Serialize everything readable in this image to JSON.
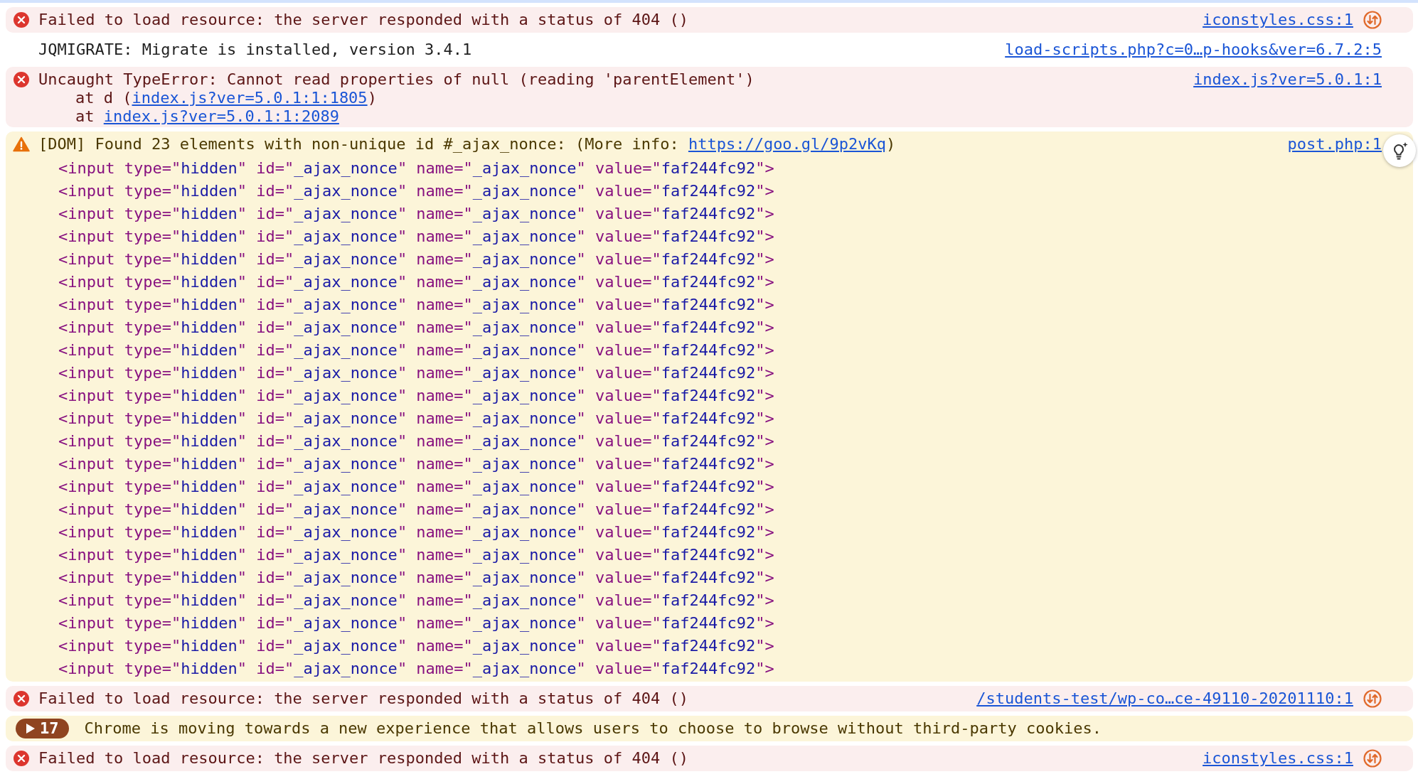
{
  "messages": [
    {
      "kind": "error",
      "text": "Failed to load resource: the server responded with a status of 404 ()",
      "source": "iconstyles.css:1",
      "network_icon": true
    },
    {
      "kind": "info",
      "text": "JQMIGRATE: Migrate is installed, version 3.4.1",
      "source": "load-scripts.php?c=0…p-hooks&ver=6.7.2:5"
    },
    {
      "kind": "error",
      "text": "Uncaught TypeError: Cannot read properties of null (reading 'parentElement')",
      "source": "index.js?ver=5.0.1:1",
      "stack": [
        {
          "prefix": "at d (",
          "link": "index.js?ver=5.0.1:1:1805",
          "suffix": ")"
        },
        {
          "prefix": "at ",
          "link": "index.js?ver=5.0.1:1:2089"
        }
      ]
    },
    {
      "kind": "warning",
      "text": "[DOM] Found 23 elements with non-unique id #_ajax_nonce: (More info: ",
      "link": "https://goo.gl/9p2vKq",
      "suffix": ")",
      "source": "post.php:1",
      "ai_button": true,
      "code_lines": [
        "<input type=\"hidden\" id=\"_ajax_nonce\" name=\"_ajax_nonce\" value=\"faf244fc92\">",
        "<input type=\"hidden\" id=\"_ajax_nonce\" name=\"_ajax_nonce\" value=\"faf244fc92\">",
        "<input type=\"hidden\" id=\"_ajax_nonce\" name=\"_ajax_nonce\" value=\"faf244fc92\">",
        "<input type=\"hidden\" id=\"_ajax_nonce\" name=\"_ajax_nonce\" value=\"faf244fc92\">",
        "<input type=\"hidden\" id=\"_ajax_nonce\" name=\"_ajax_nonce\" value=\"faf244fc92\">",
        "<input type=\"hidden\" id=\"_ajax_nonce\" name=\"_ajax_nonce\" value=\"faf244fc92\">",
        "<input type=\"hidden\" id=\"_ajax_nonce\" name=\"_ajax_nonce\" value=\"faf244fc92\">",
        "<input type=\"hidden\" id=\"_ajax_nonce\" name=\"_ajax_nonce\" value=\"faf244fc92\">",
        "<input type=\"hidden\" id=\"_ajax_nonce\" name=\"_ajax_nonce\" value=\"faf244fc92\">",
        "<input type=\"hidden\" id=\"_ajax_nonce\" name=\"_ajax_nonce\" value=\"faf244fc92\">",
        "<input type=\"hidden\" id=\"_ajax_nonce\" name=\"_ajax_nonce\" value=\"faf244fc92\">",
        "<input type=\"hidden\" id=\"_ajax_nonce\" name=\"_ajax_nonce\" value=\"faf244fc92\">",
        "<input type=\"hidden\" id=\"_ajax_nonce\" name=\"_ajax_nonce\" value=\"faf244fc92\">",
        "<input type=\"hidden\" id=\"_ajax_nonce\" name=\"_ajax_nonce\" value=\"faf244fc92\">",
        "<input type=\"hidden\" id=\"_ajax_nonce\" name=\"_ajax_nonce\" value=\"faf244fc92\">",
        "<input type=\"hidden\" id=\"_ajax_nonce\" name=\"_ajax_nonce\" value=\"faf244fc92\">",
        "<input type=\"hidden\" id=\"_ajax_nonce\" name=\"_ajax_nonce\" value=\"faf244fc92\">",
        "<input type=\"hidden\" id=\"_ajax_nonce\" name=\"_ajax_nonce\" value=\"faf244fc92\">",
        "<input type=\"hidden\" id=\"_ajax_nonce\" name=\"_ajax_nonce\" value=\"faf244fc92\">",
        "<input type=\"hidden\" id=\"_ajax_nonce\" name=\"_ajax_nonce\" value=\"faf244fc92\">",
        "<input type=\"hidden\" id=\"_ajax_nonce\" name=\"_ajax_nonce\" value=\"faf244fc92\">",
        "<input type=\"hidden\" id=\"_ajax_nonce\" name=\"_ajax_nonce\" value=\"faf244fc92\">",
        "<input type=\"hidden\" id=\"_ajax_nonce\" name=\"_ajax_nonce\" value=\"faf244fc92\">"
      ]
    },
    {
      "kind": "error",
      "text": "Failed to load resource: the server responded with a status of 404 ()",
      "source": "/students-test/wp-co…ce-49110-20201110:1",
      "network_icon": true
    },
    {
      "kind": "group",
      "count": "17",
      "text": "Chrome is moving towards a new experience that allows users to choose to browse without third-party cookies."
    },
    {
      "kind": "error",
      "text": "Failed to load resource: the server responded with a status of 404 ()",
      "source": "iconstyles.css:1",
      "network_icon": true
    }
  ]
}
